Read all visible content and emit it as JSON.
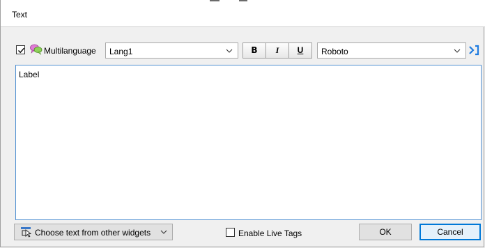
{
  "dialog": {
    "title": "Text"
  },
  "toolbar": {
    "multilanguage_checked": true,
    "multilanguage_label": "Multilanguage",
    "language": {
      "selected": "Lang1"
    },
    "bold_label": "B",
    "italic_label": "I",
    "underline_label": "U",
    "font": {
      "selected": "Roboto"
    },
    "icons": {
      "checkbox": "checkmark-icon",
      "multilanguage": "speech-bubbles-icon",
      "language_dropdown": "chevron-down-icon",
      "font_dropdown": "chevron-down-icon",
      "expand": "expand-arrow-icon"
    }
  },
  "editor": {
    "content": "Label"
  },
  "footer": {
    "choose_text_label": "Choose text from other widgets",
    "enable_live_tags_label": "Enable Live Tags",
    "enable_live_tags_checked": false,
    "ok_label": "OK",
    "cancel_label": "Cancel"
  },
  "colors": {
    "accent": "#0078d7",
    "textarea_border": "#4f8fd1",
    "expand_icon": "#1e7be0"
  }
}
